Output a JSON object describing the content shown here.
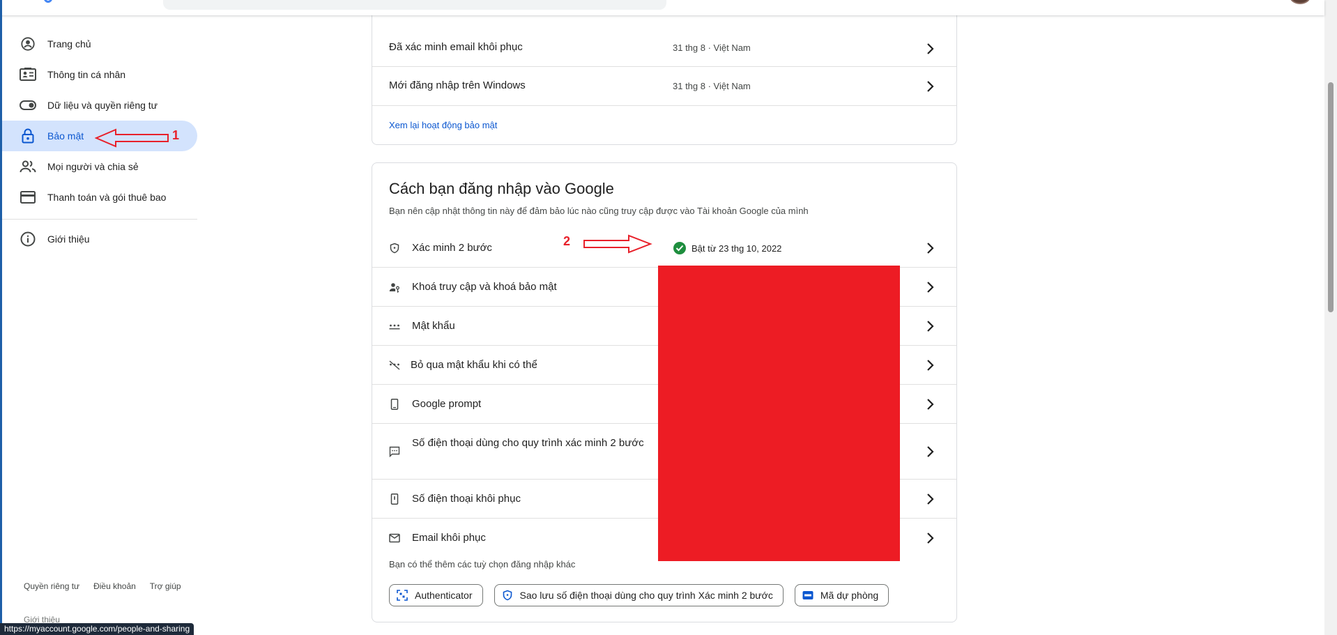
{
  "sidebar": {
    "items": [
      {
        "label": "Trang chủ",
        "icon": "account-circle-icon"
      },
      {
        "label": "Thông tin cá nhân",
        "icon": "id-card-icon"
      },
      {
        "label": "Dữ liệu và quyền riêng tư",
        "icon": "toggle-icon"
      },
      {
        "label": "Bảo mật",
        "icon": "lock-icon",
        "active": true
      },
      {
        "label": "Mọi người và chia sẻ",
        "icon": "people-icon"
      },
      {
        "label": "Thanh toán và gói thuê bao",
        "icon": "credit-card-icon"
      },
      {
        "label": "Giới thiệu",
        "icon": "info-icon"
      }
    ],
    "footer": [
      "Quyền riêng tư",
      "Điều khoản",
      "Trợ giúp"
    ],
    "footer_cut": "Giới thiệu"
  },
  "annotations": {
    "first": "1",
    "second": "2",
    "color": "#e8202a"
  },
  "activity": {
    "rows": [
      {
        "label": "Đã xác minh email khôi phục",
        "meta": "31 thg 8 · Việt Nam"
      },
      {
        "label": "Mới đăng nhập trên Windows",
        "meta": "31 thg 8 · Việt Nam"
      }
    ],
    "link": "Xem lại hoạt động bảo mật"
  },
  "signin": {
    "title": "Cách bạn đăng nhập vào Google",
    "subtitle": "Bạn nên cập nhật thông tin này để đảm bảo lúc nào cũng truy cập được vào Tài khoản Google của mình",
    "rows": [
      {
        "label": "Xác minh 2 bước",
        "icon": "shield-icon",
        "status": "Bật từ 23 thg 10, 2022"
      },
      {
        "label": "Khoá truy cập và khoá bảo mật",
        "icon": "passkey-icon"
      },
      {
        "label": "Mật khẩu",
        "icon": "password-dots-icon"
      },
      {
        "label": "Bỏ qua mật khẩu khi có thể",
        "icon": "skip-password-icon"
      },
      {
        "label": "Google prompt",
        "icon": "phone-icon"
      },
      {
        "label": "Số điện thoại dùng cho quy trình xác minh 2 bước",
        "icon": "sms-icon"
      },
      {
        "label": "Số điện thoại khôi phục",
        "icon": "recovery-phone-icon"
      },
      {
        "label": "Email khôi phục",
        "icon": "mail-icon"
      }
    ],
    "more_text": "Bạn có thể thêm các tuỳ chọn đăng nhập khác",
    "chips": [
      {
        "label": "Authenticator",
        "icon": "qr-scan-icon"
      },
      {
        "label": "Sao lưu số điện thoại dùng cho quy trình Xác minh 2 bước",
        "icon": "shield-icon"
      },
      {
        "label": "Mã dự phòng",
        "icon": "backup-codes-icon"
      }
    ]
  },
  "status_url": "https://myaccount.google.com/people-and-sharing",
  "colors": {
    "accent": "#0b57d0",
    "active_bg": "#d3e3fd",
    "success": "#1e8e3e",
    "redaction": "#ed1c24"
  }
}
